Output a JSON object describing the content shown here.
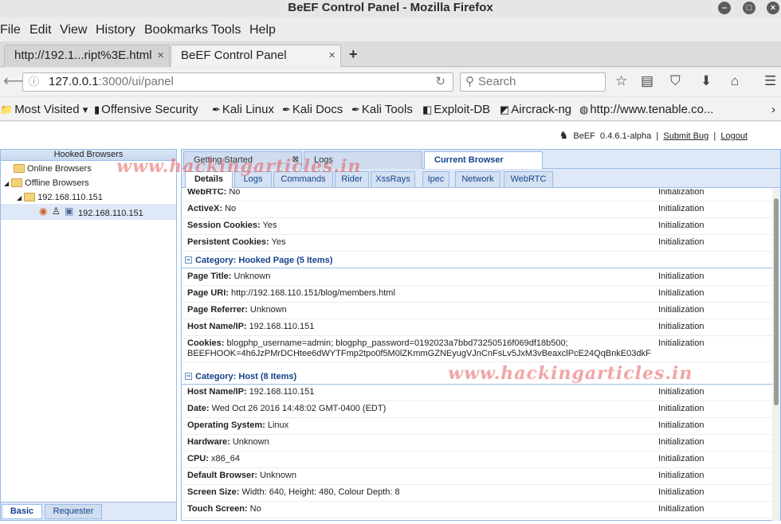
{
  "window": {
    "title": "BeEF Control Panel - Mozilla Firefox"
  },
  "menu": [
    "File",
    "Edit",
    "View",
    "History",
    "Bookmarks",
    "Tools",
    "Help"
  ],
  "tabs": [
    {
      "label": "http://192.1...ript%3E.html"
    },
    {
      "label": "BeEF Control Panel"
    }
  ],
  "nav": {
    "url_host": "127.0.0.1",
    "url_path": ":3000/ui/panel",
    "search_placeholder": "Search"
  },
  "bookmarks": [
    "Most Visited",
    "Offensive Security",
    "Kali Linux",
    "Kali Docs",
    "Kali Tools",
    "Exploit-DB",
    "Aircrack-ng",
    "http://www.tenable.co..."
  ],
  "beef": {
    "name": "BeEF",
    "version": "0.4.6.1-alpha",
    "submit_bug": "Submit  Bug",
    "separator": "|",
    "logout": "Logout"
  },
  "left": {
    "title": "Hooked Browsers",
    "online": "Online Browsers",
    "offline": "Offline Browsers",
    "ip_folder": "192.168.110.151",
    "ip_browser": "192.168.110.151",
    "tabs": [
      "Basic",
      "Requester"
    ]
  },
  "right": {
    "top_tabs": [
      "Getting Started",
      "Logs",
      "Current Browser"
    ],
    "sub_tabs": [
      "Details",
      "Logs",
      "Commands",
      "Rider",
      "XssRays",
      "Ipec",
      "Network",
      "WebRTC"
    ]
  },
  "details": {
    "browser_rows": [
      {
        "key": "WebRTC:",
        "value": " No",
        "source": "Initialization"
      },
      {
        "key": "ActiveX:",
        "value": " No",
        "source": "Initialization"
      },
      {
        "key": "Session Cookies:",
        "value": " Yes",
        "source": "Initialization"
      },
      {
        "key": "Persistent Cookies:",
        "value": " Yes",
        "source": "Initialization"
      }
    ],
    "cat_page": "Category: Hooked Page (5 Items)",
    "page_rows": [
      {
        "key": "Page Title:",
        "value": " Unknown",
        "source": "Initialization"
      },
      {
        "key": "Page URI:",
        "value": " http://192.168.110.151/blog/members.html",
        "source": "Initialization"
      },
      {
        "key": "Page Referrer:",
        "value": " Unknown",
        "source": "Initialization"
      },
      {
        "key": "Host Name/IP:",
        "value": " 192.168.110.151",
        "source": "Initialization"
      }
    ],
    "cookies": {
      "key": "Cookies:",
      "value": " blogphp_username=admin; blogphp_password=0192023a7bbd73250516f069df18b500;",
      "value2": "BEEFHOOK=4h6JzPMrDCHtee6dWYTFmp2tpo0f5M0lZKmmGZNEyugVJnCnFsLv5JxM3vBeaxclPcE24QqBnkE03dkF",
      "source": "Initialization"
    },
    "cat_host": "Category: Host (8 Items)",
    "host_rows": [
      {
        "key": "Host Name/IP:",
        "value": " 192.168.110.151",
        "source": "Initialization"
      },
      {
        "key": "Date:",
        "value": " Wed Oct 26 2016 14:48:02 GMT-0400 (EDT)",
        "source": "Initialization"
      },
      {
        "key": "Operating System:",
        "value": " Linux",
        "source": "Initialization"
      },
      {
        "key": "Hardware:",
        "value": " Unknown",
        "source": "Initialization"
      },
      {
        "key": "CPU:",
        "value": " x86_64",
        "source": "Initialization"
      },
      {
        "key": "Default Browser:",
        "value": " Unknown",
        "source": "Initialization"
      },
      {
        "key": "Screen Size:",
        "value": " Width: 640, Height: 480, Colour Depth: 8",
        "source": "Initialization"
      },
      {
        "key": "Touch Screen:",
        "value": " No",
        "source": "Initialization"
      }
    ]
  },
  "watermark": "www.hackingarticles.in"
}
